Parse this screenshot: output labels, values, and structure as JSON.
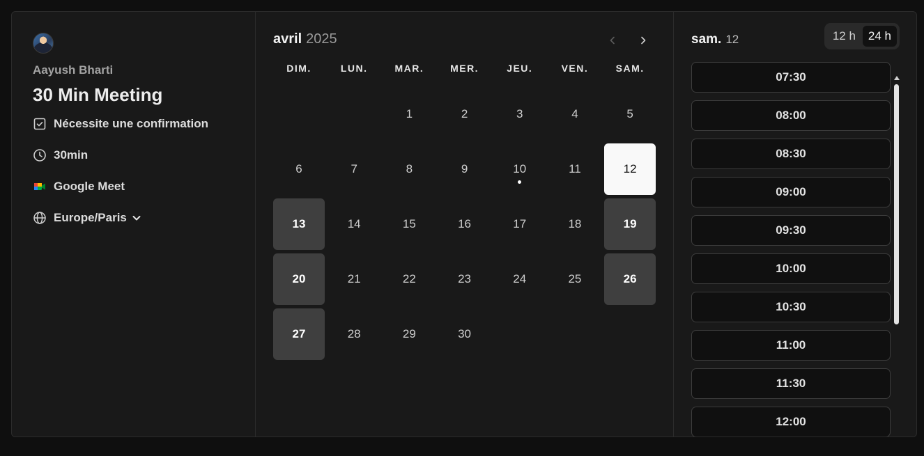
{
  "profile": {
    "host_name": "Aayush Bharti",
    "event_title": "30 Min Meeting",
    "requires_confirmation": "Nécessite une confirmation",
    "duration": "30min",
    "location": "Google Meet",
    "timezone": "Europe/Paris"
  },
  "calendar": {
    "month": "avril",
    "year": "2025",
    "weekdays": [
      "DIM.",
      "LUN.",
      "MAR.",
      "MER.",
      "JEU.",
      "VEN.",
      "SAM."
    ],
    "leading_blanks": 2,
    "days": [
      {
        "n": "1",
        "state": "normal"
      },
      {
        "n": "2",
        "state": "normal"
      },
      {
        "n": "3",
        "state": "normal"
      },
      {
        "n": "4",
        "state": "normal"
      },
      {
        "n": "5",
        "state": "normal"
      },
      {
        "n": "6",
        "state": "normal"
      },
      {
        "n": "7",
        "state": "normal"
      },
      {
        "n": "8",
        "state": "normal"
      },
      {
        "n": "9",
        "state": "normal"
      },
      {
        "n": "10",
        "state": "normal",
        "today": true
      },
      {
        "n": "11",
        "state": "normal"
      },
      {
        "n": "12",
        "state": "selected"
      },
      {
        "n": "13",
        "state": "available"
      },
      {
        "n": "14",
        "state": "normal"
      },
      {
        "n": "15",
        "state": "normal"
      },
      {
        "n": "16",
        "state": "normal"
      },
      {
        "n": "17",
        "state": "normal"
      },
      {
        "n": "18",
        "state": "normal"
      },
      {
        "n": "19",
        "state": "available"
      },
      {
        "n": "20",
        "state": "available"
      },
      {
        "n": "21",
        "state": "normal"
      },
      {
        "n": "22",
        "state": "normal"
      },
      {
        "n": "23",
        "state": "normal"
      },
      {
        "n": "24",
        "state": "normal"
      },
      {
        "n": "25",
        "state": "normal"
      },
      {
        "n": "26",
        "state": "available"
      },
      {
        "n": "27",
        "state": "available"
      },
      {
        "n": "28",
        "state": "normal"
      },
      {
        "n": "29",
        "state": "normal"
      },
      {
        "n": "30",
        "state": "normal"
      }
    ]
  },
  "slots_panel": {
    "date_label": "sam.",
    "day_number": "12",
    "format_12h": "12 h",
    "format_24h": "24 h",
    "active_format": "24 h",
    "times": [
      "07:30",
      "08:00",
      "08:30",
      "09:00",
      "09:30",
      "10:00",
      "10:30",
      "11:00",
      "11:30",
      "12:00"
    ]
  },
  "colors": {
    "background": "#0f0f0f",
    "card": "#191919",
    "available_day": "#3f3f3f",
    "selected_day": "#f9f9f9"
  }
}
